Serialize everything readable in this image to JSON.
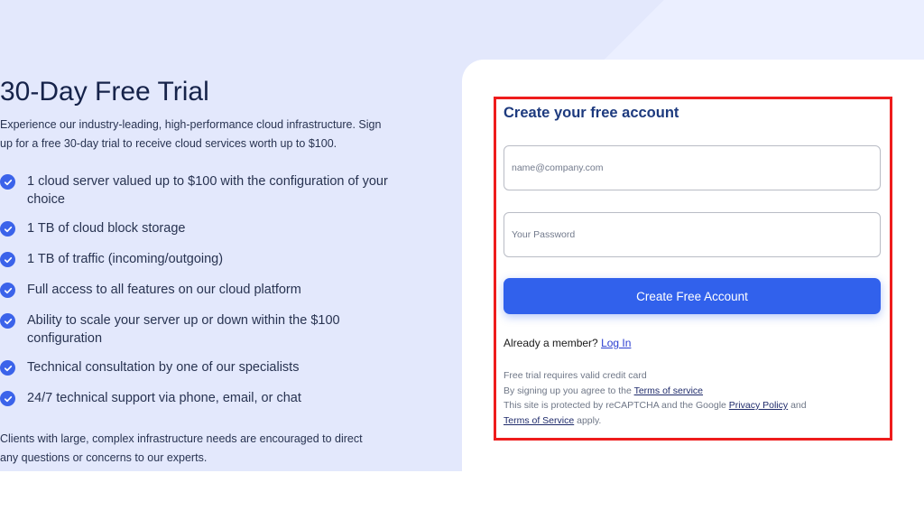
{
  "hero": {
    "title": "30-Day Free Trial",
    "intro": "Experience our industry-leading, high-performance cloud infrastructure. Sign up for a free 30-day trial to receive cloud services worth up to $100.",
    "features": [
      "1 cloud server valued up to $100 with the configuration of your choice",
      "1 TB of cloud block storage",
      "1 TB of traffic (incoming/outgoing)",
      "Full access to all features on our cloud platform",
      "Ability to scale your server up or down within the $100 configuration",
      "Technical consultation by one of our specialists",
      "24/7 technical support via phone, email, or chat"
    ],
    "closing": "Clients with large, complex infrastructure needs are encouraged to direct any questions or concerns to our experts."
  },
  "form": {
    "title": "Create your free account",
    "email_placeholder": "name@company.com",
    "password_placeholder": "Your Password",
    "submit_label": "Create Free Account",
    "member_text": "Already a member?",
    "login_link": "Log In",
    "legal": {
      "line1": "Free trial requires valid credit card",
      "line2_prefix": "By signing up you agree to the",
      "terms_service_link": "Terms of service",
      "line3_prefix": "This site is protected by reCAPTCHA and the Google",
      "privacy_link": "Privacy Policy",
      "line3_and": "and",
      "tos_link": "Terms of Service",
      "line4_suffix": "apply."
    }
  },
  "colors": {
    "accent": "#3161ec",
    "highlight_border": "#ee1c1c",
    "hero_background": "#e3e8fc"
  },
  "icons": {
    "feature_bullet": "check-circle-icon"
  }
}
